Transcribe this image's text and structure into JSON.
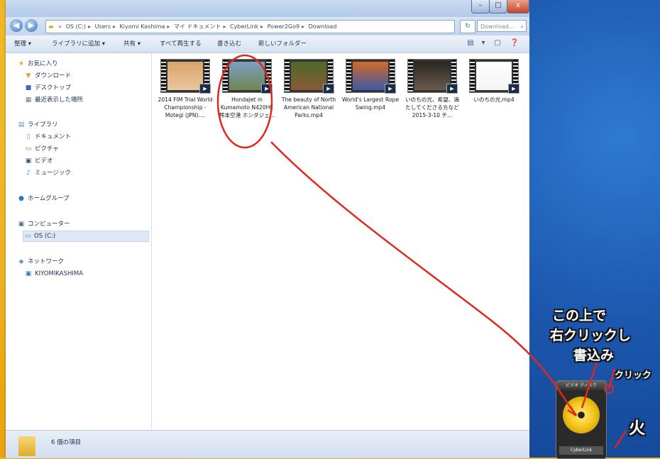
{
  "window": {
    "buttons": {
      "minimize": "–",
      "maximize": "□",
      "close": "x"
    }
  },
  "address": {
    "segments": [
      "OS (C:)",
      "Users",
      "Kiyomi Kashima",
      "マイ ドキュメント",
      "CyberLink",
      "Power2Go9",
      "Download"
    ],
    "search_placeholder": "Download..."
  },
  "toolbar": {
    "organize": "整理 ▾",
    "add_library": "ライブラリに追加 ▾",
    "share": "共有 ▾",
    "play_all": "すべて再生する",
    "burn": "書き込む",
    "new_folder": "新しいフォルダー"
  },
  "nav": {
    "favorites": "お気に入り",
    "downloads": "ダウンロード",
    "desktop": "デスクトップ",
    "recent": "最近表示した場所",
    "libraries": "ライブラリ",
    "documents": "ドキュメント",
    "pictures": "ピクチャ",
    "videos": "ビデオ",
    "music": "ミュージック",
    "homegroup": "ホームグループ",
    "computer": "コンピューター",
    "os_drive": "OS (C:)",
    "network": "ネットワーク",
    "network_pc": "KIYOMIKASHIMA"
  },
  "files": [
    {
      "name": "2014 FIM Trial World Championship - Motegi (JPN)....",
      "colors": [
        "#d9a46a",
        "#e9c79c"
      ]
    },
    {
      "name": "HondaJet in Kumamoto N420HE 熊本空港 ホンダジェ...",
      "colors": [
        "#7b9fc4",
        "#6f8750"
      ]
    },
    {
      "name": "The beauty of North American National Parks.mp4",
      "colors": [
        "#4d6a2c",
        "#8a5a34"
      ]
    },
    {
      "name": "World's Largest Rope Swing.mp4",
      "colors": [
        "#d5682a",
        "#3b5aa8"
      ]
    },
    {
      "name": "いのちの光、希望、満たしてくださる方など 2015-3-10 チ...",
      "colors": [
        "#2a2623",
        "#6a5a4e"
      ]
    },
    {
      "name": "いのちの光.mp4",
      "colors": [
        "#ffffff",
        "#f4f4f4"
      ]
    }
  ],
  "status": {
    "count": "6 個の項目"
  },
  "gadget": {
    "title": "ビデオ ディスク",
    "label": "CyberLink"
  },
  "annotations": {
    "line1": "この上で",
    "line2": "右クリックし",
    "line3": "書込み",
    "click": "クリック",
    "fire": "火"
  },
  "colors": {
    "annotation_red": "#e0281c",
    "desktop_blue": "#1c58ae",
    "frame_gold": "#e9a812"
  }
}
